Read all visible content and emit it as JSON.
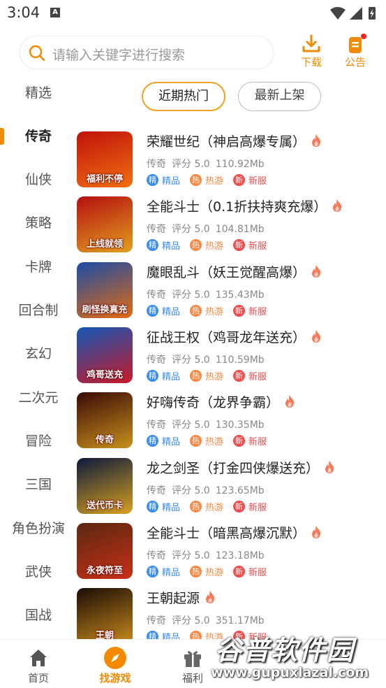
{
  "status_bar": {
    "time": "3:04",
    "notif_letter": "A"
  },
  "search": {
    "placeholder": "请输入关键字进行搜索"
  },
  "header": {
    "download_label": "下载",
    "notice_label": "公告"
  },
  "sidebar": {
    "items": [
      "精选",
      "传奇",
      "仙侠",
      "策略",
      "卡牌",
      "回合制",
      "玄幻",
      "二次元",
      "冒险",
      "三国",
      "角色扮演",
      "武侠",
      "国战"
    ],
    "active": "传奇"
  },
  "tabs": {
    "hot": "近期热门",
    "new": "最新上架"
  },
  "tag_labels": {
    "jing_badge": "精",
    "jing": "精品",
    "re_badge": "热",
    "re": "热游",
    "xin_badge": "新",
    "xin": "新服"
  },
  "games": [
    {
      "name": "荣耀世纪（神启高爆专属）",
      "category": "传奇",
      "rating": "评分 5.0",
      "size": "110.92Mb",
      "icon_text": "福利不停",
      "colors": [
        "#c0120a",
        "#f07010"
      ]
    },
    {
      "name": "全能斗士（0.1折扶持爽充爆）",
      "category": "传奇",
      "rating": "评分 5.0",
      "size": "104.81Mb",
      "icon_text": "上线就领",
      "colors": [
        "#b50f0f",
        "#e2a020"
      ]
    },
    {
      "name": "魔眼乱斗（妖王觉醒高爆）",
      "category": "传奇",
      "rating": "评分 5.0",
      "size": "135.43Mb",
      "icon_text": "刷怪换真充",
      "colors": [
        "#1a4ca8",
        "#e46a10"
      ]
    },
    {
      "name": "征战王权（鸡哥龙年送充）",
      "category": "传奇",
      "rating": "评分 5.0",
      "size": "110.59Mb",
      "icon_text": "鸡哥送充",
      "colors": [
        "#1458b8",
        "#c81a28"
      ]
    },
    {
      "name": "好嗨传奇（龙界争霸）",
      "category": "传奇",
      "rating": "评分 5.0",
      "size": "130.35Mb",
      "icon_text": "传奇",
      "colors": [
        "#3a0a06",
        "#c8901c"
      ]
    },
    {
      "name": "龙之剑圣（打金四侠爆送充）",
      "category": "传奇",
      "rating": "评分 5.0",
      "size": "123.65Mb",
      "icon_text": "送代币卡",
      "colors": [
        "#0c1a3c",
        "#d8a020"
      ]
    },
    {
      "name": "全能斗士（暗黑高爆沉默）",
      "category": "传奇",
      "rating": "评分 5.0",
      "size": "123.18Mb",
      "icon_text": "永夜符至",
      "colors": [
        "#5a2810",
        "#c83018"
      ]
    },
    {
      "name": "王朝起源",
      "category": "传奇",
      "rating": "评分 5.0",
      "size": "351.17Mb",
      "icon_text": "王朝",
      "colors": [
        "#1a0c06",
        "#c88a1c"
      ]
    }
  ],
  "bottom_nav": {
    "home": "首页",
    "find": "找游戏",
    "gift": "福利"
  },
  "watermark": {
    "title": "谷普软件园",
    "url": "www.gupuxlazal.com"
  },
  "colors": {
    "accent": "#f58a00",
    "hot_tag": "#f58a46",
    "new_tag": "#ef4c4c",
    "fine_tag": "#3a8cf0"
  }
}
